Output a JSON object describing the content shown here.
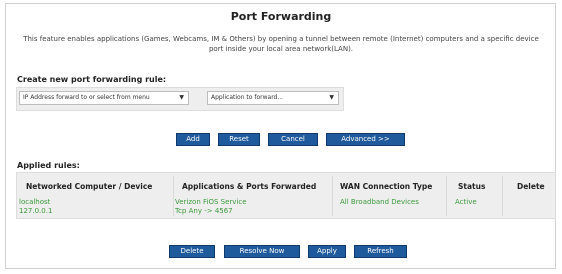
{
  "page": {
    "title": "Port Forwarding",
    "description": "This feature enables applications (Games, Webcams, IM & Others) by opening a tunnel between remote (Internet) computers and a specific device port inside your local area network(LAN)."
  },
  "create_rule": {
    "label": "Create new port forwarding rule:",
    "ip_select_value": "IP Address forward to or select from menu",
    "app_select_value": "Application to forward..."
  },
  "rule_buttons": {
    "add": "Add",
    "reset": "Reset",
    "cancel": "Cancel",
    "advanced": "Advanced >>"
  },
  "applied_rules": {
    "label": "Applied rules:",
    "columns": [
      "Networked Computer / Device",
      "Applications & Ports Forwarded",
      "WAN Connection Type",
      "Status",
      "Delete"
    ],
    "rows": [
      {
        "device_name": "localhost",
        "device_ip": "127.0.0.1",
        "app_name": "Verizon FiOS Service",
        "app_ports": "Tcp Any -> 4567",
        "wan_type": "All Broadband Devices",
        "status": "Active"
      }
    ]
  },
  "bottom_buttons": {
    "delete": "Delete",
    "resolve_now": "Resolve Now",
    "apply": "Apply",
    "refresh": "Refresh"
  },
  "colors": {
    "button_bg": "#1f5a9c",
    "row_text": "#3c9a3c"
  }
}
